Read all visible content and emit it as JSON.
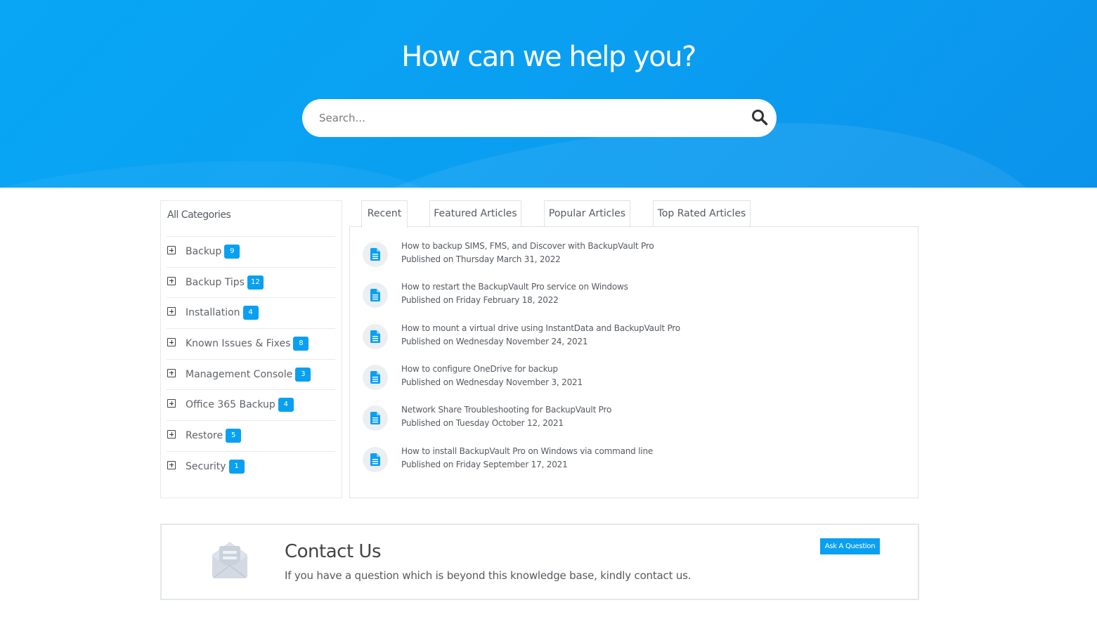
{
  "hero": {
    "title": "How can we help you?",
    "search_placeholder": "Search...",
    "search_icon": "search-icon"
  },
  "sidebar": {
    "title": "All Categories",
    "expand_icon": "plus-square-icon",
    "items": [
      {
        "label": "Backup",
        "count": "9"
      },
      {
        "label": "Backup Tips",
        "count": "12"
      },
      {
        "label": "Installation",
        "count": "4"
      },
      {
        "label": "Known Issues & Fixes",
        "count": "8"
      },
      {
        "label": "Management Console",
        "count": "3"
      },
      {
        "label": "Office 365 Backup",
        "count": "4"
      },
      {
        "label": "Restore",
        "count": "5"
      },
      {
        "label": "Security",
        "count": "1"
      }
    ]
  },
  "tabs": [
    {
      "label": "Recent",
      "active": true
    },
    {
      "label": "Featured Articles",
      "active": false
    },
    {
      "label": "Popular Articles",
      "active": false
    },
    {
      "label": "Top Rated Articles",
      "active": false
    }
  ],
  "articles": {
    "icon": "document-icon",
    "items": [
      {
        "title": "How to backup SIMS, FMS, and Discover with BackupVault Pro",
        "date": "Published on Thursday March 31, 2022"
      },
      {
        "title": "How to restart the BackupVault Pro service on Windows",
        "date": "Published on Friday February 18, 2022"
      },
      {
        "title": "How to mount a virtual drive using InstantData and BackupVault Pro",
        "date": "Published on Wednesday November 24, 2021"
      },
      {
        "title": "How to configure OneDrive for backup",
        "date": "Published on Wednesday November 3, 2021"
      },
      {
        "title": "Network Share Troubleshooting for BackupVault Pro",
        "date": "Published on Tuesday October 12, 2021"
      },
      {
        "title": "How to install BackupVault Pro on Windows via command line",
        "date": "Published on Friday September 17, 2021"
      }
    ]
  },
  "contact": {
    "title": "Contact Us",
    "text": "If you have a question which is beyond this knowledge base, kindly contact us.",
    "button_label": "Ask A Question",
    "icon": "open-envelope-icon"
  },
  "colors": {
    "brand_blue": "#0aa0f2",
    "text": "#555a60",
    "border": "#dfe3e7"
  }
}
